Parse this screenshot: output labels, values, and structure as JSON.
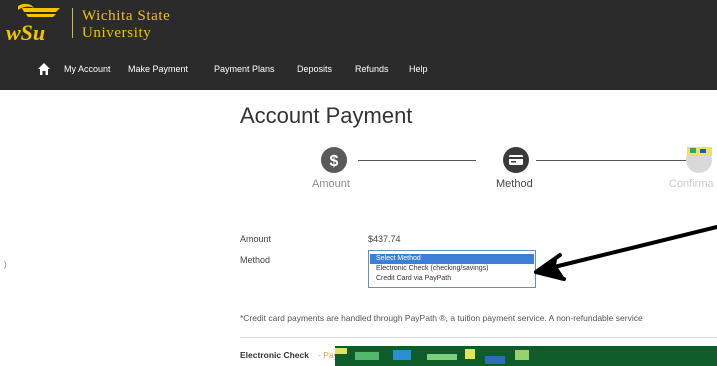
{
  "brand": {
    "line1": "Wichita State",
    "line2": "University",
    "abbr": "WSU",
    "gold": "#f2c500",
    "header_bg": "#2b2b2b"
  },
  "nav": {
    "home_icon": "home-icon",
    "items": [
      "My Account",
      "Make Payment",
      "Payment Plans",
      "Deposits",
      "Refunds",
      "Help"
    ]
  },
  "page": {
    "title": "Account Payment"
  },
  "steps": [
    {
      "label": "Amount",
      "icon": "dollar-icon",
      "state": "done",
      "color": "#5a5a5a"
    },
    {
      "label": "Method",
      "icon": "credit-card-icon",
      "state": "current",
      "color": "#3a3a3a"
    },
    {
      "label": "Confirma",
      "icon": "check-icon",
      "state": "upcoming",
      "color": "#d9d9d9"
    }
  ],
  "form": {
    "amount_label": "Amount",
    "amount_value": "$437.74",
    "method_label": "Method",
    "method_options": [
      "Select Method",
      "Electronic Check (checking/savings)",
      "Credit Card via PayPath"
    ],
    "selected_index": 0,
    "selection_color": "#3c7fd7"
  },
  "left_mark": ")",
  "note": "*Credit card payments are handled through PayPath ®, a tuition payment service. A non-refundable service",
  "echeck": {
    "title": "Electronic Check",
    "subtitle": "- Paym"
  },
  "annotation": {
    "arrow_color": "#000000"
  }
}
